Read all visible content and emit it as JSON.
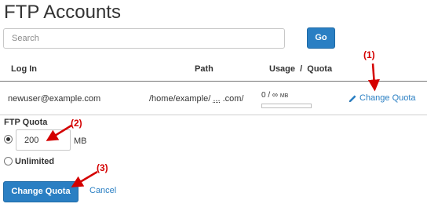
{
  "page": {
    "title": "FTP Accounts"
  },
  "search": {
    "placeholder": "Search",
    "go_label": "Go"
  },
  "table": {
    "headers": {
      "login": "Log In",
      "path": "Path",
      "usage_quota": "Usage  /  Quota"
    },
    "rows": [
      {
        "login": "newuser@example.com",
        "path_start": "/home/example/",
        "path_ellipsis": "...",
        "path_end": ".com/",
        "usage_text": "0 / ∞",
        "usage_unit": "MB",
        "usage_fraction": 0,
        "action_label": "Change Quota",
        "action_icon": "pencil-icon"
      }
    ]
  },
  "quota_form": {
    "label": "FTP Quota",
    "quota_value": "200",
    "unit": "MB",
    "selected_option": "custom",
    "unlimited_label": "Unlimited",
    "submit_label": "Change Quota",
    "cancel_label": "Cancel"
  },
  "callouts": {
    "one": "(1)",
    "two": "(2)",
    "three": "(3)"
  },
  "colors": {
    "primary": "#2a7fc3",
    "callout_red": "#d40000",
    "text": "#333333"
  }
}
